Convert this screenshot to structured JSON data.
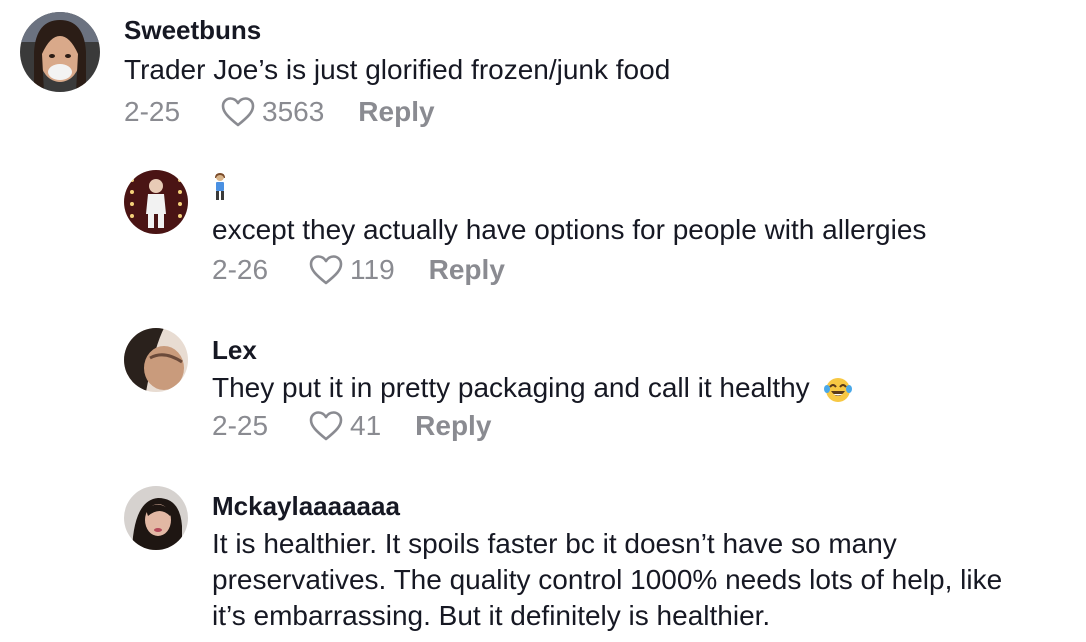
{
  "comments": [
    {
      "username": "Sweetbuns",
      "text": "Trader Joe’s is just glorified frozen/junk food",
      "date": "2-25",
      "likes": "3563",
      "reply_label": "Reply"
    },
    {
      "username": "",
      "username_emoji": "person-emoji",
      "text": "except they actually have options for people with allergies",
      "date": "2-26",
      "likes": "119",
      "reply_label": "Reply"
    },
    {
      "username": "Lex",
      "text": "They put it in pretty packaging and call it healthy",
      "text_emoji": "laughing-tears-emoji",
      "date": "2-25",
      "likes": "41",
      "reply_label": "Reply"
    },
    {
      "username": "Mckaylaaaaaaa",
      "text_lines": [
        "It is healthier. It spoils faster bc it doesn’t have so many",
        "preservatives. The quality control 1000% needs lots of help, like",
        "it’s embarrassing. But it definitely is healthier."
      ]
    }
  ]
}
